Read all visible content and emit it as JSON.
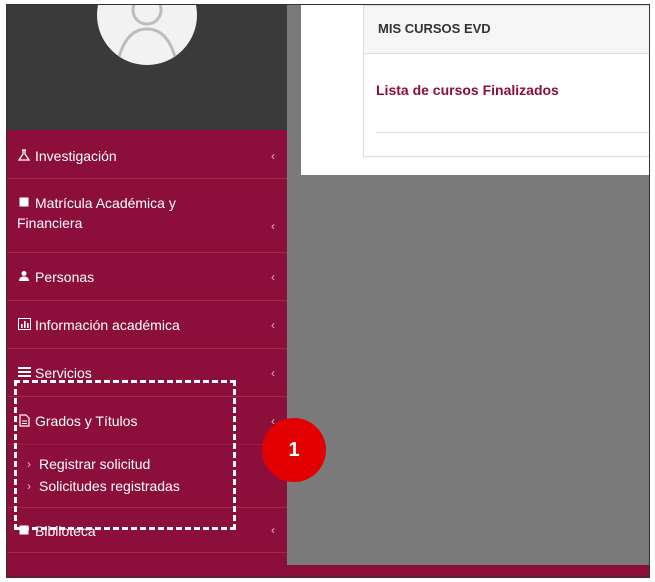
{
  "colors": {
    "sidebar": "#8c0e3a",
    "profile_bg": "#3a3a3a",
    "content_bg": "#7a7a7a",
    "accent_link": "#8c0e3a",
    "badge": "#e30000"
  },
  "card": {
    "title": "MIS CURSOS EVD",
    "link": "Lista de cursos Finalizados"
  },
  "menu": {
    "investigacion": {
      "label": "Investigación",
      "icon": "flask-icon"
    },
    "matricula": {
      "label_line1": "Matrícula Académica y",
      "label_line2": "Financiera",
      "icon": "book-icon"
    },
    "personas": {
      "label": "Personas",
      "icon": "user-icon"
    },
    "informacion": {
      "label": "Información académica",
      "icon": "chart-icon"
    },
    "servicios": {
      "label": "Servicios",
      "icon": "list-icon"
    },
    "grados": {
      "label": "Grados y Títulos",
      "icon": "document-icon",
      "submenu": {
        "registrar": "Registrar solicitud",
        "solicitudes": "Solicitudes registradas"
      }
    },
    "biblioteca": {
      "label": "Biblioteca",
      "icon": "book-icon"
    }
  },
  "annotation": {
    "number": "1"
  }
}
